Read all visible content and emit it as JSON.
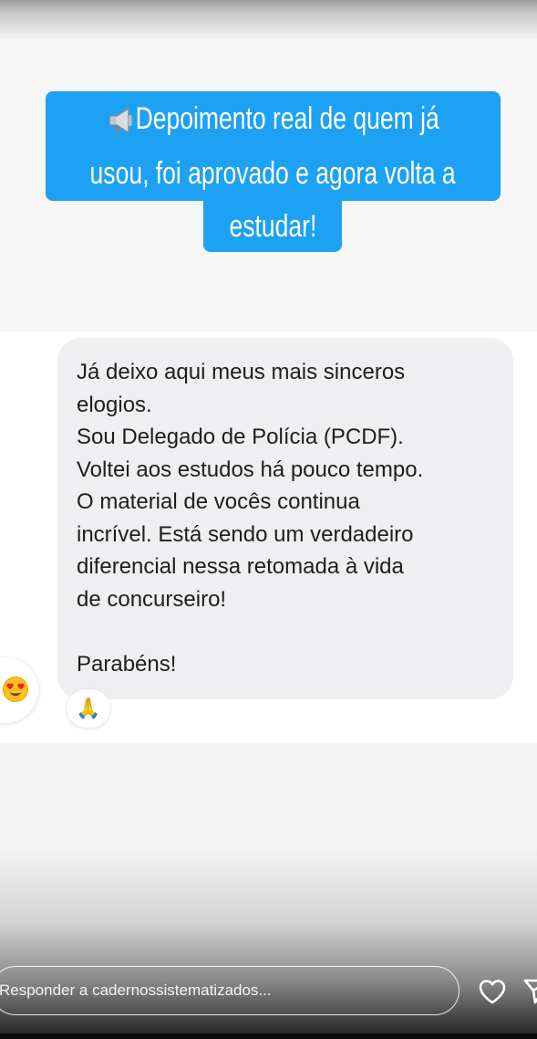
{
  "headline": {
    "icon": "megaphone-icon",
    "line1": "Depoimento real de quem já",
    "line2": "usou, foi aprovado e agora volta a",
    "line3": "estudar!"
  },
  "message": {
    "lines": [
      "Já deixo aqui meus mais sinceros",
      "elogios.",
      "Sou Delegado de Polícia (PCDF).",
      "Voltei aos estudos há pouco tempo.",
      "O material de vocês continua",
      "incrível. Está sendo um verdadeiro",
      "diferencial nessa retomada à vida",
      "de concurseiro!"
    ],
    "closing": "Parabéns!"
  },
  "reactions": {
    "left_emoji": "heart-eyes-emoji",
    "bubble_emoji": "🙏"
  },
  "reply": {
    "placeholder": "Responder a cadernossistematizados..."
  },
  "icons": {
    "like": "heart-icon",
    "send": "send-icon"
  },
  "colors": {
    "headline_bg": "#1da1f2",
    "bubble_bg": "#efeff1"
  }
}
